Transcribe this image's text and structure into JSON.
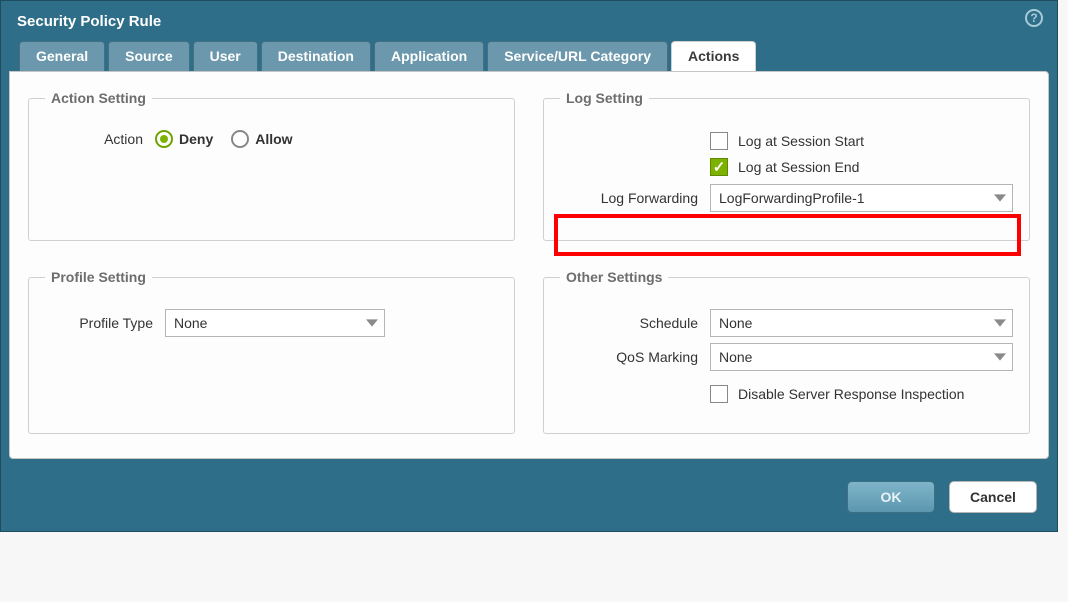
{
  "dialog": {
    "title": "Security Policy Rule"
  },
  "tabs": [
    {
      "label": "General"
    },
    {
      "label": "Source"
    },
    {
      "label": "User"
    },
    {
      "label": "Destination"
    },
    {
      "label": "Application"
    },
    {
      "label": "Service/URL Category"
    },
    {
      "label": "Actions",
      "active": true
    }
  ],
  "actionSetting": {
    "legend": "Action Setting",
    "label": "Action",
    "options": [
      {
        "label": "Deny",
        "selected": true
      },
      {
        "label": "Allow",
        "selected": false
      }
    ]
  },
  "logSetting": {
    "legend": "Log Setting",
    "sessionStart": {
      "label": "Log at Session Start",
      "checked": false
    },
    "sessionEnd": {
      "label": "Log at Session End",
      "checked": true
    },
    "forwarding": {
      "label": "Log Forwarding",
      "value": "LogForwardingProfile-1"
    }
  },
  "profileSetting": {
    "legend": "Profile Setting",
    "type": {
      "label": "Profile Type",
      "value": "None"
    }
  },
  "otherSettings": {
    "legend": "Other Settings",
    "schedule": {
      "label": "Schedule",
      "value": "None"
    },
    "qos": {
      "label": "QoS Marking",
      "value": "None"
    },
    "disableInspect": {
      "label": "Disable Server Response Inspection",
      "checked": false
    }
  },
  "footer": {
    "ok": "OK",
    "cancel": "Cancel"
  }
}
